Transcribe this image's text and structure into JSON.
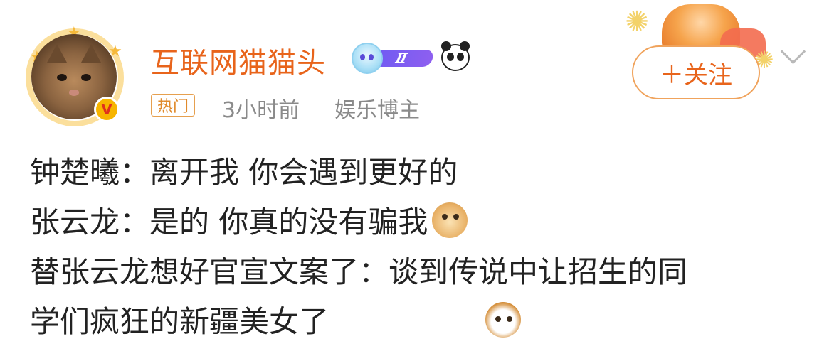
{
  "author": {
    "name": "互联网猫猫头",
    "level": "Ⅱ",
    "tag": "热门",
    "time": "3小时前",
    "role": "娱乐博主",
    "verified_mark": "V"
  },
  "follow": {
    "label": "＋关注"
  },
  "post": {
    "lines": [
      "钟楚曦：离开我 你会遇到更好的",
      "张云龙：是的 你真的没有骗我",
      "替张云龙想好官宣文案了：谈到传说中让招生的同",
      "学们疯狂的新疆美女了"
    ]
  },
  "icons": {
    "level_ghost": "ghost-level-icon",
    "panda": "panda-icon",
    "chevron": "chevron-down-icon",
    "emoji_doge": "doge-emoji-icon",
    "emoji_cat": "cat-emoji-icon"
  },
  "colors": {
    "username": "#e8641b",
    "follow_border": "#f0a35c",
    "meta_text": "#8a8a8a",
    "body_text": "#222222"
  }
}
